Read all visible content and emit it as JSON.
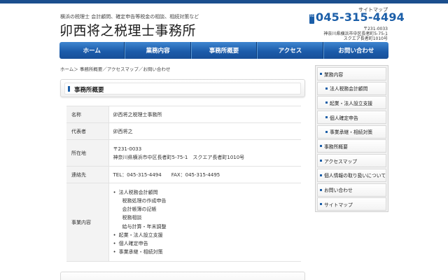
{
  "header": {
    "tagline": "横浜の税理士 会計顧問、確定申告等税金の相談、相続対策など",
    "logo": "卯西将之税理士事務所",
    "sitemap_link": "サイトマップ",
    "tel_badge": "TEL",
    "tel": "045-315-4494",
    "postal": "〒231-0033",
    "address_line1": "神奈川県横浜市中区長者町5-75-1",
    "address_line2": "スクエア長者町1010号"
  },
  "nav": [
    {
      "label": "ホーム"
    },
    {
      "label": "業務内容"
    },
    {
      "label": "事務所概要"
    },
    {
      "label": "アクセス"
    },
    {
      "label": "お問い合わせ"
    }
  ],
  "breadcrumb": "ホーム＞ 事務所概要／アクセスマップ／お問い合わせ",
  "section_title": "事務所概要",
  "office": {
    "name_label": "名称",
    "name_value": "卯西将之税理士事務所",
    "rep_label": "代表者",
    "rep_value": "卯西将之",
    "addr_label": "所在地",
    "addr_postal": "〒231-0033",
    "addr_value": "神奈川県横浜市中区長者町5-75-1　スクエア長者町1010号",
    "contact_label": "連絡先",
    "tel_value": "TEL：045-315-4494",
    "fax_value": "FAX：045-315-4495",
    "services_label": "事業内容",
    "services": [
      {
        "text": "法人税務会計顧問",
        "kind": "main"
      },
      {
        "text": "税務処理の作成申告",
        "kind": "sub"
      },
      {
        "text": "会計帳簿の記帳",
        "kind": "sub"
      },
      {
        "text": "税務相談",
        "kind": "sub"
      },
      {
        "text": "給与計算・年末調整",
        "kind": "sub"
      },
      {
        "text": "起業・法人設立支援",
        "kind": "main"
      },
      {
        "text": "個人確定申告",
        "kind": "main"
      },
      {
        "text": "事業承継・相続対策",
        "kind": "main"
      }
    ]
  },
  "sidebar": {
    "items": [
      {
        "label": "業務内容",
        "level": "top"
      },
      {
        "label": "法人税務会計顧問",
        "level": "sub"
      },
      {
        "label": "起業・法人設立支援",
        "level": "sub"
      },
      {
        "label": "個人確定申告",
        "level": "sub"
      },
      {
        "label": "事業承継・相続対策",
        "level": "sub"
      },
      {
        "label": "事務所概要",
        "level": "top"
      },
      {
        "label": "アクセスマップ",
        "level": "top"
      },
      {
        "label": "個人情報の取り扱いについて",
        "level": "top"
      },
      {
        "label": "お問い合わせ",
        "level": "top"
      },
      {
        "label": "サイトマップ",
        "level": "top"
      }
    ]
  },
  "colors": {
    "brand_blue": "#1b5ea8",
    "nav_top": "#3f86d0",
    "nav_bottom": "#174f98"
  }
}
